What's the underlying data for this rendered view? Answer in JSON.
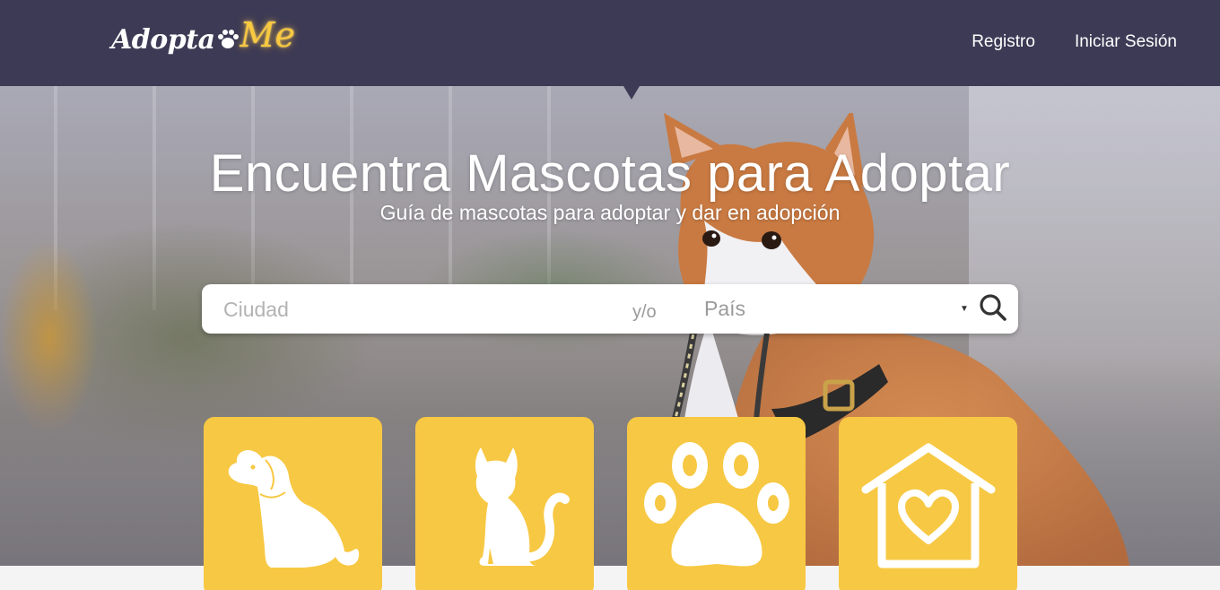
{
  "brand": {
    "name_part1": "Adopta",
    "name_part2": "Me",
    "accent_color": "#f9c940",
    "header_color": "#3d3a55"
  },
  "nav": {
    "register": "Registro",
    "login": "Iniciar Sesión"
  },
  "hero": {
    "title": "Encuentra Mascotas para Adoptar",
    "subtitle": "Guía de mascotas para adoptar y dar en adopción"
  },
  "search": {
    "city_placeholder": "Ciudad",
    "connector": "y/o",
    "country_placeholder": "País",
    "icon": "search-icon"
  },
  "categories": [
    {
      "icon": "dog-icon"
    },
    {
      "icon": "cat-icon"
    },
    {
      "icon": "paw-icon"
    },
    {
      "icon": "heart-house-icon"
    }
  ],
  "card_color": "#f7c843"
}
